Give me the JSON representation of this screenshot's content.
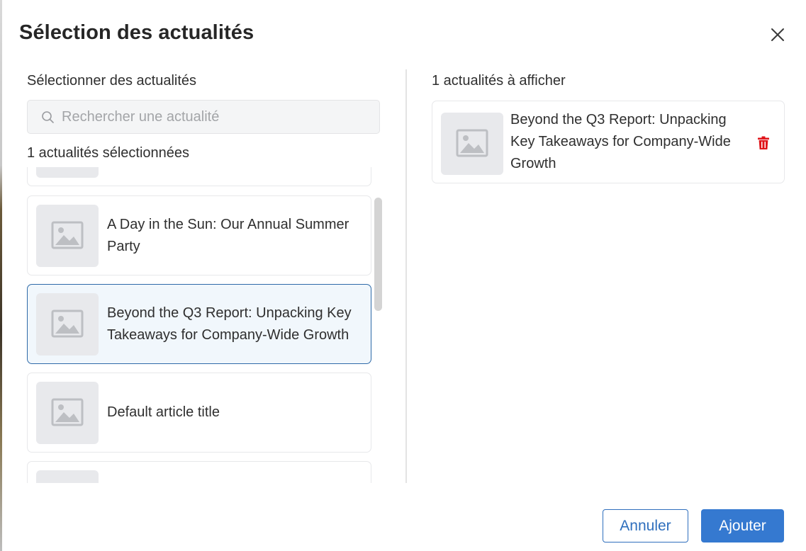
{
  "modal": {
    "title": "Sélection des actualités",
    "close_icon": "close-icon"
  },
  "left_panel": {
    "label": "Sélectionner des actualités",
    "search": {
      "placeholder": "Rechercher une actualité",
      "value": "",
      "icon": "search-icon"
    },
    "selected_count": "1 actualités sélectionnées",
    "articles": [
      {
        "title": "",
        "selected": false,
        "thumbnail_icon": "image-placeholder-icon"
      },
      {
        "title": "A Day in the Sun: Our Annual Summer Party",
        "selected": false,
        "thumbnail_icon": "image-placeholder-icon"
      },
      {
        "title": "Beyond the Q3 Report: Unpacking Key Takeaways for Company-Wide Growth",
        "selected": true,
        "thumbnail_icon": "image-placeholder-icon"
      },
      {
        "title": "Default article title",
        "selected": false,
        "thumbnail_icon": "image-placeholder-icon"
      },
      {
        "title": "",
        "selected": false,
        "thumbnail_icon": "image-placeholder-icon"
      }
    ]
  },
  "right_panel": {
    "label": "1 actualités à afficher",
    "items": [
      {
        "title": "Beyond the Q3 Report: Unpacking Key Takeaways for Company-Wide Growth",
        "thumbnail_icon": "image-placeholder-icon",
        "delete_icon": "trash-icon"
      }
    ]
  },
  "footer": {
    "cancel_label": "Annuler",
    "add_label": "Ajouter"
  },
  "colors": {
    "accent": "#3579d0",
    "selected_bg": "#f1f7fc",
    "selected_border": "#2e6aa8",
    "delete": "#e0161b",
    "thumb_bg": "#e8e9ec"
  }
}
